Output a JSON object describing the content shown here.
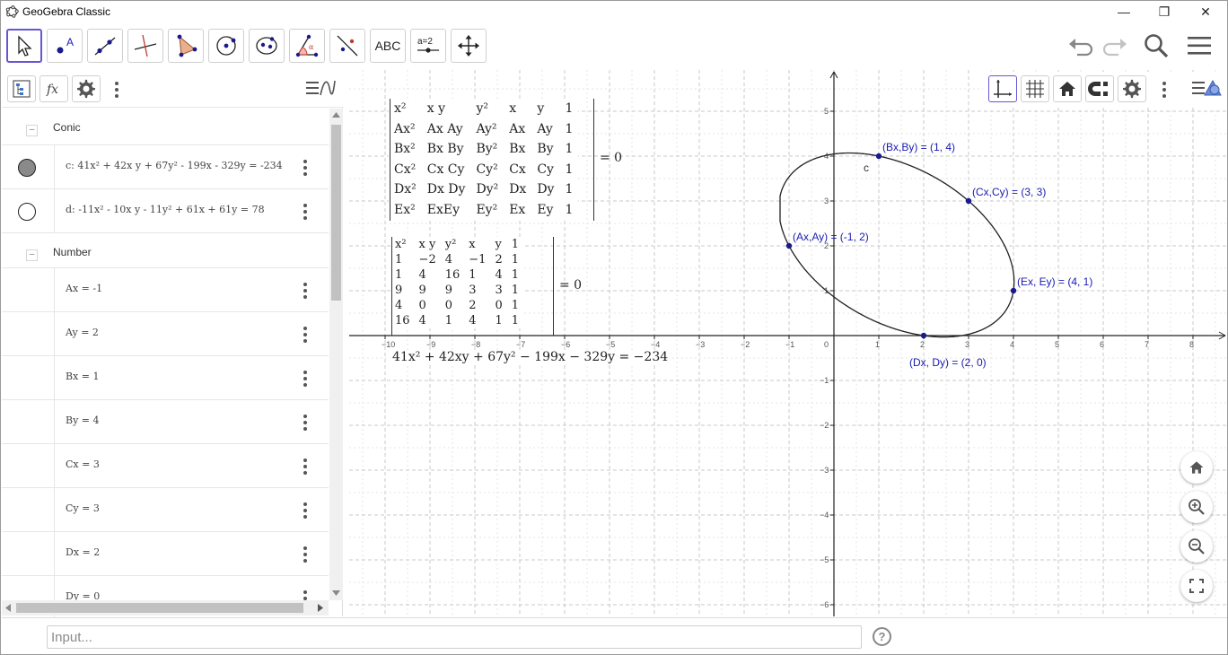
{
  "window": {
    "title": "GeoGebra Classic",
    "minimize_glyph": "—",
    "maximize_glyph": "❐",
    "close_glyph": "✕"
  },
  "toolbar": {
    "text_tool_label": "ABC",
    "slider_tool_label": "a=2"
  },
  "algebra": {
    "groups": {
      "conic": "Conic",
      "number": "Number"
    },
    "collapse_glyph": "–",
    "conics": [
      {
        "text": "c: 41x² + 42x y + 67y² - 199x - 329y = -234",
        "filled": true
      },
      {
        "text": "d: -11x² - 10x y - 11y² + 61x + 61y = 78",
        "filled": false
      }
    ],
    "numbers": [
      {
        "text": "Ax = -1"
      },
      {
        "text": "Ay = 2"
      },
      {
        "text": "Bx = 1"
      },
      {
        "text": "By = 4"
      },
      {
        "text": "Cx = 3"
      },
      {
        "text": "Cy = 3"
      },
      {
        "text": "Dx = 2"
      },
      {
        "text": "Dy = 0"
      }
    ]
  },
  "graphics": {
    "symbolic_matrix": {
      "rows": [
        [
          "x²",
          "x y",
          "y²",
          "x",
          "y",
          "1"
        ],
        [
          "Ax²",
          "Ax Ay",
          "Ay²",
          "Ax",
          "Ay",
          "1"
        ],
        [
          "Bx²",
          "Bx By",
          "By²",
          "Bx",
          "By",
          "1"
        ],
        [
          "Cx²",
          "Cx Cy",
          "Cy²",
          "Cx",
          "Cy",
          "1"
        ],
        [
          "Dx²",
          "Dx Dy",
          "Dy²",
          "Dx",
          "Dy",
          "1"
        ],
        [
          "Ex²",
          "ExEy",
          "Ey²",
          "Ex",
          "Ey",
          "1"
        ]
      ],
      "equals": "= 0"
    },
    "numeric_matrix": {
      "rows": [
        [
          "x²",
          "x y",
          "y²",
          "x",
          "y",
          "1"
        ],
        [
          "1",
          "−2",
          "4",
          "−1",
          "2",
          "1"
        ],
        [
          "1",
          "4",
          "16",
          "1",
          "4",
          "1"
        ],
        [
          "9",
          "9",
          "9",
          "3",
          "3",
          "1"
        ],
        [
          "4",
          "0",
          "0",
          "2",
          "0",
          "1"
        ],
        [
          "16",
          "4",
          "1",
          "4",
          "1",
          "1"
        ]
      ],
      "equals": "= 0"
    },
    "equation": "41x² + 42xy + 67y² − 199x − 329y  =  −234",
    "conic_label": "c",
    "points": [
      {
        "label": "(Ax,Ay) = (-1, 2)",
        "x": -1,
        "y": 2
      },
      {
        "label": "(Bx,By) = (1, 4)",
        "x": 1,
        "y": 4
      },
      {
        "label": "(Cx,Cy) = (3, 3)",
        "x": 3,
        "y": 3
      },
      {
        "label": "(Dx, Dy) = (2, 0)",
        "x": 2,
        "y": 0
      },
      {
        "label": "(Ex, Ey) = (4, 1)",
        "x": 4,
        "y": 1
      }
    ],
    "conic": {
      "A": 41,
      "B": 42,
      "C": 67,
      "D": -199,
      "E": -329,
      "F": 234
    },
    "axes": {
      "x_ticks": [
        -10,
        -9,
        -8,
        -7,
        -6,
        -5,
        -4,
        -3,
        -2,
        -1,
        0,
        1,
        2,
        3,
        4,
        5,
        6,
        7,
        8
      ],
      "y_ticks": [
        5,
        4,
        3,
        2,
        1,
        -1,
        -2,
        -3,
        -4,
        -5,
        -6
      ],
      "grid": true
    }
  },
  "input": {
    "placeholder": "Input...",
    "help_glyph": "?"
  },
  "colors": {
    "accent": "#6557d2",
    "point": "#1a1ab4",
    "grid_major": "#c8c8c8",
    "grid_minor": "#e6e6e6"
  }
}
